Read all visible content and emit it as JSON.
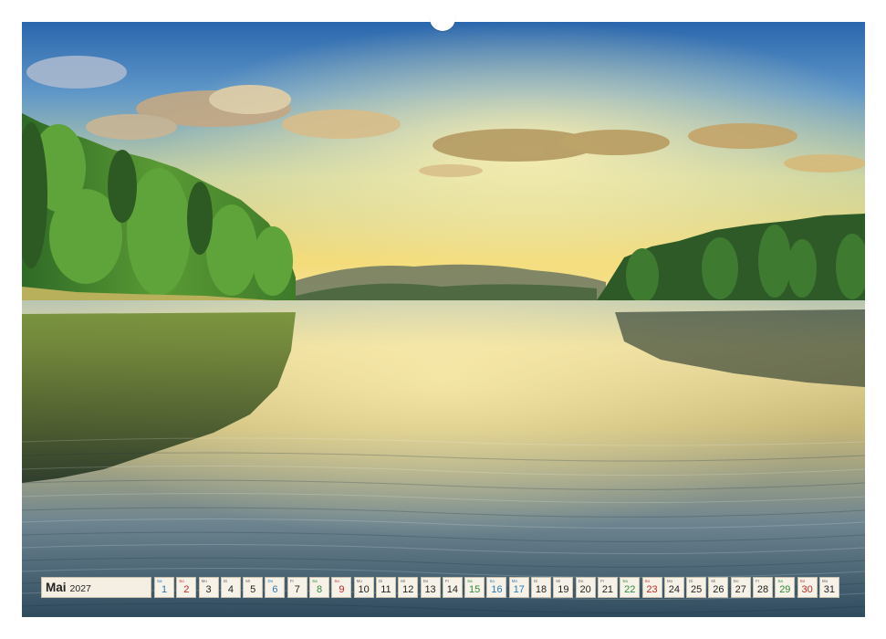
{
  "calendar": {
    "month": "Mai",
    "year": "2027",
    "days": [
      {
        "wd": "Sa",
        "num": "1",
        "type": "hol"
      },
      {
        "wd": "So",
        "num": "2",
        "type": "sun"
      },
      {
        "wd": "Mo",
        "num": "3",
        "type": ""
      },
      {
        "wd": "Di",
        "num": "4",
        "type": ""
      },
      {
        "wd": "Mi",
        "num": "5",
        "type": ""
      },
      {
        "wd": "Do",
        "num": "6",
        "type": "hol"
      },
      {
        "wd": "Fr",
        "num": "7",
        "type": ""
      },
      {
        "wd": "Sa",
        "num": "8",
        "type": "sat"
      },
      {
        "wd": "So",
        "num": "9",
        "type": "sun"
      },
      {
        "wd": "Mo",
        "num": "10",
        "type": ""
      },
      {
        "wd": "Di",
        "num": "11",
        "type": ""
      },
      {
        "wd": "Mi",
        "num": "12",
        "type": ""
      },
      {
        "wd": "Do",
        "num": "13",
        "type": ""
      },
      {
        "wd": "Fr",
        "num": "14",
        "type": ""
      },
      {
        "wd": "Sa",
        "num": "15",
        "type": "sat"
      },
      {
        "wd": "So",
        "num": "16",
        "type": "hol"
      },
      {
        "wd": "Mo",
        "num": "17",
        "type": "hol"
      },
      {
        "wd": "Di",
        "num": "18",
        "type": ""
      },
      {
        "wd": "Mi",
        "num": "19",
        "type": ""
      },
      {
        "wd": "Do",
        "num": "20",
        "type": ""
      },
      {
        "wd": "Fr",
        "num": "21",
        "type": ""
      },
      {
        "wd": "Sa",
        "num": "22",
        "type": "sat"
      },
      {
        "wd": "So",
        "num": "23",
        "type": "sun"
      },
      {
        "wd": "Mo",
        "num": "24",
        "type": ""
      },
      {
        "wd": "Di",
        "num": "25",
        "type": ""
      },
      {
        "wd": "Mi",
        "num": "26",
        "type": ""
      },
      {
        "wd": "Do",
        "num": "27",
        "type": ""
      },
      {
        "wd": "Fr",
        "num": "28",
        "type": ""
      },
      {
        "wd": "Sa",
        "num": "29",
        "type": "sat"
      },
      {
        "wd": "So",
        "num": "30",
        "type": "sun"
      },
      {
        "wd": "Mo",
        "num": "31",
        "type": ""
      }
    ]
  },
  "colors": {
    "sky_top": "#2f6fb6",
    "sky_glow": "#f2d77a",
    "forest": "#2e6b2a",
    "water": "#3d5a6a"
  }
}
